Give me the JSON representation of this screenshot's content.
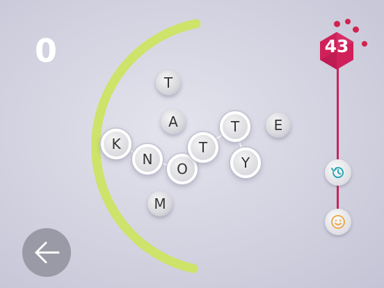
{
  "score": "0",
  "level": "43",
  "colors": {
    "arc": "#cde36a",
    "accent": "#c8235a",
    "back_button": "#9a9aa6",
    "undo_icon": "#2aa7b5",
    "smile_icon": "#f0a43a"
  },
  "tiles": [
    {
      "letter": "T",
      "selected": false
    },
    {
      "letter": "A",
      "selected": false
    },
    {
      "letter": "K",
      "selected": true
    },
    {
      "letter": "N",
      "selected": true
    },
    {
      "letter": "O",
      "selected": true
    },
    {
      "letter": "T",
      "selected": true
    },
    {
      "letter": "T",
      "selected": true
    },
    {
      "letter": "Y",
      "selected": true
    },
    {
      "letter": "E",
      "selected": false
    },
    {
      "letter": "M",
      "selected": false
    }
  ],
  "icons": {
    "back": "arrow-left-icon",
    "undo": "history-icon",
    "hint": "smiley-icon"
  }
}
